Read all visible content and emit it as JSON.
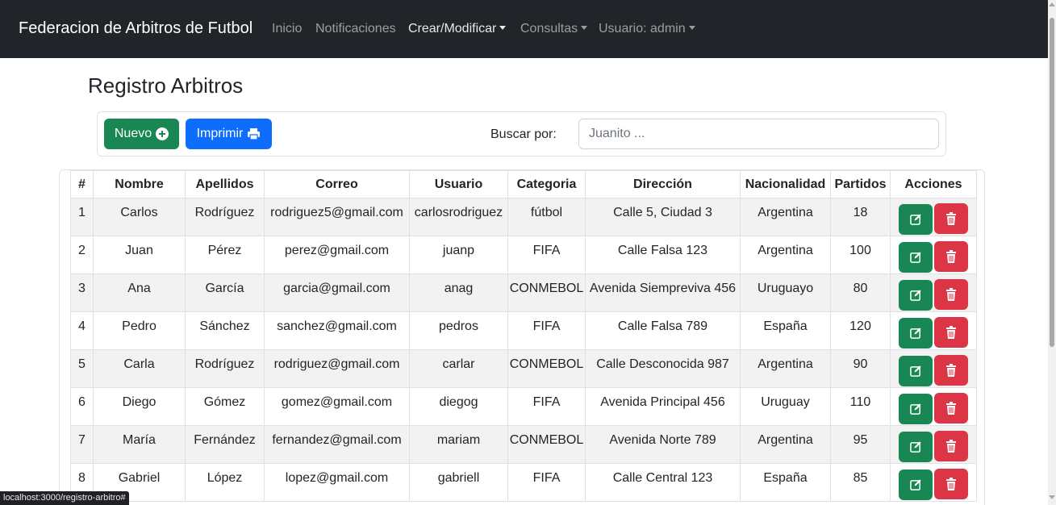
{
  "navbar": {
    "brand": "Federacion de Arbitros de Futbol",
    "links": [
      {
        "label": "Inicio",
        "dropdown": false
      },
      {
        "label": "Notificaciones",
        "dropdown": false
      },
      {
        "label": "Crear/Modificar",
        "dropdown": true,
        "active": true
      },
      {
        "label": "Consultas",
        "dropdown": true
      },
      {
        "label": "Usuario: admin",
        "dropdown": true
      }
    ]
  },
  "page": {
    "title": "Registro Arbitros"
  },
  "toolbar": {
    "nuevo_label": "Nuevo",
    "imprimir_label": "Imprimir",
    "search_label": "Buscar por:",
    "search_placeholder": "Juanito ...",
    "search_value": ""
  },
  "table": {
    "headers": [
      "#",
      "Nombre",
      "Apellidos",
      "Correo",
      "Usuario",
      "Categoria",
      "Dirección",
      "Nacionalidad",
      "Partidos",
      "Acciones"
    ],
    "rows": [
      {
        "num": "1",
        "nombre": "Carlos",
        "apellidos": "Rodríguez",
        "correo": "rodriguez5@gmail.com",
        "usuario": "carlosrodriguez",
        "categoria": "fútbol",
        "direccion": "Calle 5, Ciudad 3",
        "nacionalidad": "Argentina",
        "partidos": "18"
      },
      {
        "num": "2",
        "nombre": "Juan",
        "apellidos": "Pérez",
        "correo": "perez@gmail.com",
        "usuario": "juanp",
        "categoria": "FIFA",
        "direccion": "Calle Falsa 123",
        "nacionalidad": "Argentina",
        "partidos": "100"
      },
      {
        "num": "3",
        "nombre": "Ana",
        "apellidos": "García",
        "correo": "garcia@gmail.com",
        "usuario": "anag",
        "categoria": "CONMEBOL",
        "direccion": "Avenida Siempreviva 456",
        "nacionalidad": "Uruguayo",
        "partidos": "80"
      },
      {
        "num": "4",
        "nombre": "Pedro",
        "apellidos": "Sánchez",
        "correo": "sanchez@gmail.com",
        "usuario": "pedros",
        "categoria": "FIFA",
        "direccion": "Calle Falsa 789",
        "nacionalidad": "España",
        "partidos": "120"
      },
      {
        "num": "5",
        "nombre": "Carla",
        "apellidos": "Rodríguez",
        "correo": "rodriguez@gmail.com",
        "usuario": "carlar",
        "categoria": "CONMEBOL",
        "direccion": "Calle Desconocida 987",
        "nacionalidad": "Argentina",
        "partidos": "90"
      },
      {
        "num": "6",
        "nombre": "Diego",
        "apellidos": "Gómez",
        "correo": "gomez@gmail.com",
        "usuario": "diegog",
        "categoria": "FIFA",
        "direccion": "Avenida Principal 456",
        "nacionalidad": "Uruguay",
        "partidos": "110"
      },
      {
        "num": "7",
        "nombre": "María",
        "apellidos": "Fernández",
        "correo": "fernandez@gmail.com",
        "usuario": "mariam",
        "categoria": "CONMEBOL",
        "direccion": "Avenida Norte 789",
        "nacionalidad": "Argentina",
        "partidos": "95"
      },
      {
        "num": "8",
        "nombre": "Gabriel",
        "apellidos": "López",
        "correo": "lopez@gmail.com",
        "usuario": "gabriell",
        "categoria": "FIFA",
        "direccion": "Calle Central 123",
        "nacionalidad": "España",
        "partidos": "85"
      }
    ]
  },
  "status_bar": {
    "url": "localhost:3000/registro-arbitro#"
  },
  "colors": {
    "navbar_bg": "#212529",
    "success": "#198754",
    "primary": "#0d6efd",
    "danger": "#dc3545"
  },
  "icons": {
    "nuevo": "plus-circle-icon",
    "imprimir": "printer-icon",
    "edit": "edit-icon",
    "delete": "trash-icon"
  }
}
